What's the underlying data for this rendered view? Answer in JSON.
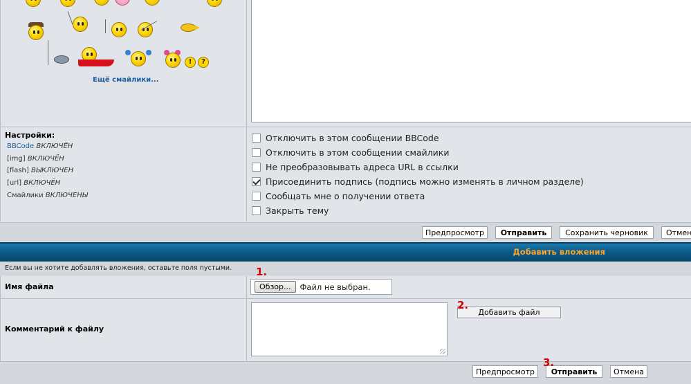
{
  "smilies": {
    "more_link": "Ещё смайлики..."
  },
  "settings": {
    "title": "Настройки:",
    "items": [
      {
        "key": "BBCode",
        "value": "ВКЛЮЧЁН",
        "is_link": true
      },
      {
        "key": "[img]",
        "value": "ВКЛЮЧЁН",
        "is_link": false
      },
      {
        "key": "[flash]",
        "value": "ВЫКЛЮЧЕН",
        "is_link": false
      },
      {
        "key": "[url]",
        "value": "ВКЛЮЧЁН",
        "is_link": false
      },
      {
        "key": "Смайлики",
        "value": "ВКЛЮЧЕНЫ",
        "is_link": false
      }
    ]
  },
  "options": [
    {
      "label": "Отключить в этом сообщении BBCode",
      "checked": false
    },
    {
      "label": "Отключить в этом сообщении смайлики",
      "checked": false
    },
    {
      "label": "Не преобразовывать адреса URL в ссылки",
      "checked": false
    },
    {
      "label": "Присоединить подпись (подпись можно изменять в личном разделе)",
      "checked": true
    },
    {
      "label": "Сообщать мне о получении ответа",
      "checked": false
    },
    {
      "label": "Закрыть тему",
      "checked": false
    }
  ],
  "post_buttons": {
    "preview": "Предпросмотр",
    "submit": "Отправить",
    "save_draft": "Сохранить черновик",
    "cancel": "Отмена"
  },
  "attachments": {
    "title": "Добавить вложения",
    "hint": "Если вы не хотите добавлять вложения, оставьте поля пустыми.",
    "filename_label": "Имя файла",
    "browse_label": "Обзор...",
    "file_status": "Файл не выбран.",
    "comment_label": "Комментарий к файлу",
    "add_file_label": "Добавить файл"
  },
  "bottom_buttons": {
    "preview": "Предпросмотр",
    "submit": "Отправить",
    "cancel": "Отмена"
  },
  "steps": [
    "1.",
    "2.",
    "3."
  ],
  "colors": {
    "header_gradient_top": "#1b7aac",
    "header_gradient_bottom": "#06446a",
    "header_title": "#f4a731",
    "link": "#1a5fa0",
    "step_marker": "#d40000"
  }
}
